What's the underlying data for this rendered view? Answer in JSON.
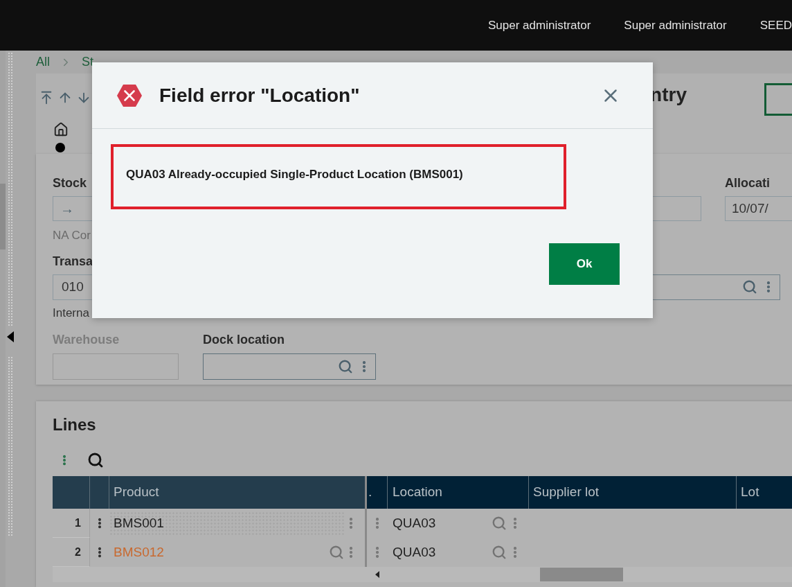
{
  "top_bar": {
    "items": [
      "Super administrator",
      "Super administrator",
      "SEED"
    ]
  },
  "breadcrumb": [
    "All",
    "St"
  ],
  "header": {
    "title": "ntry"
  },
  "form": {
    "stock": {
      "label": "Stock",
      "value": "→",
      "caption": "NA Cor"
    },
    "allocation": {
      "label": "Allocati",
      "value": "10/07/"
    },
    "transaction": {
      "label": "Transa",
      "value": "010",
      "caption": "Interna"
    },
    "warehouse": {
      "label": "Warehouse",
      "disabled": true
    },
    "dock_location": {
      "label": "Dock location",
      "disabled": false
    }
  },
  "lines": {
    "title": "Lines",
    "columns": [
      "Product",
      ".",
      "Location",
      "Supplier lot",
      "Lot"
    ],
    "rows": [
      {
        "number": "1",
        "product": "BMS001",
        "location": "QUA03",
        "focused": true,
        "error": false
      },
      {
        "number": "2",
        "product": "BMS012",
        "location": "QUA03",
        "focused": false,
        "error": true
      }
    ]
  },
  "dialog": {
    "title": "Field error \"Location\"",
    "message": "QUA03 Already-occupied Single-Product Location (BMS001)",
    "button": "Ok"
  }
}
